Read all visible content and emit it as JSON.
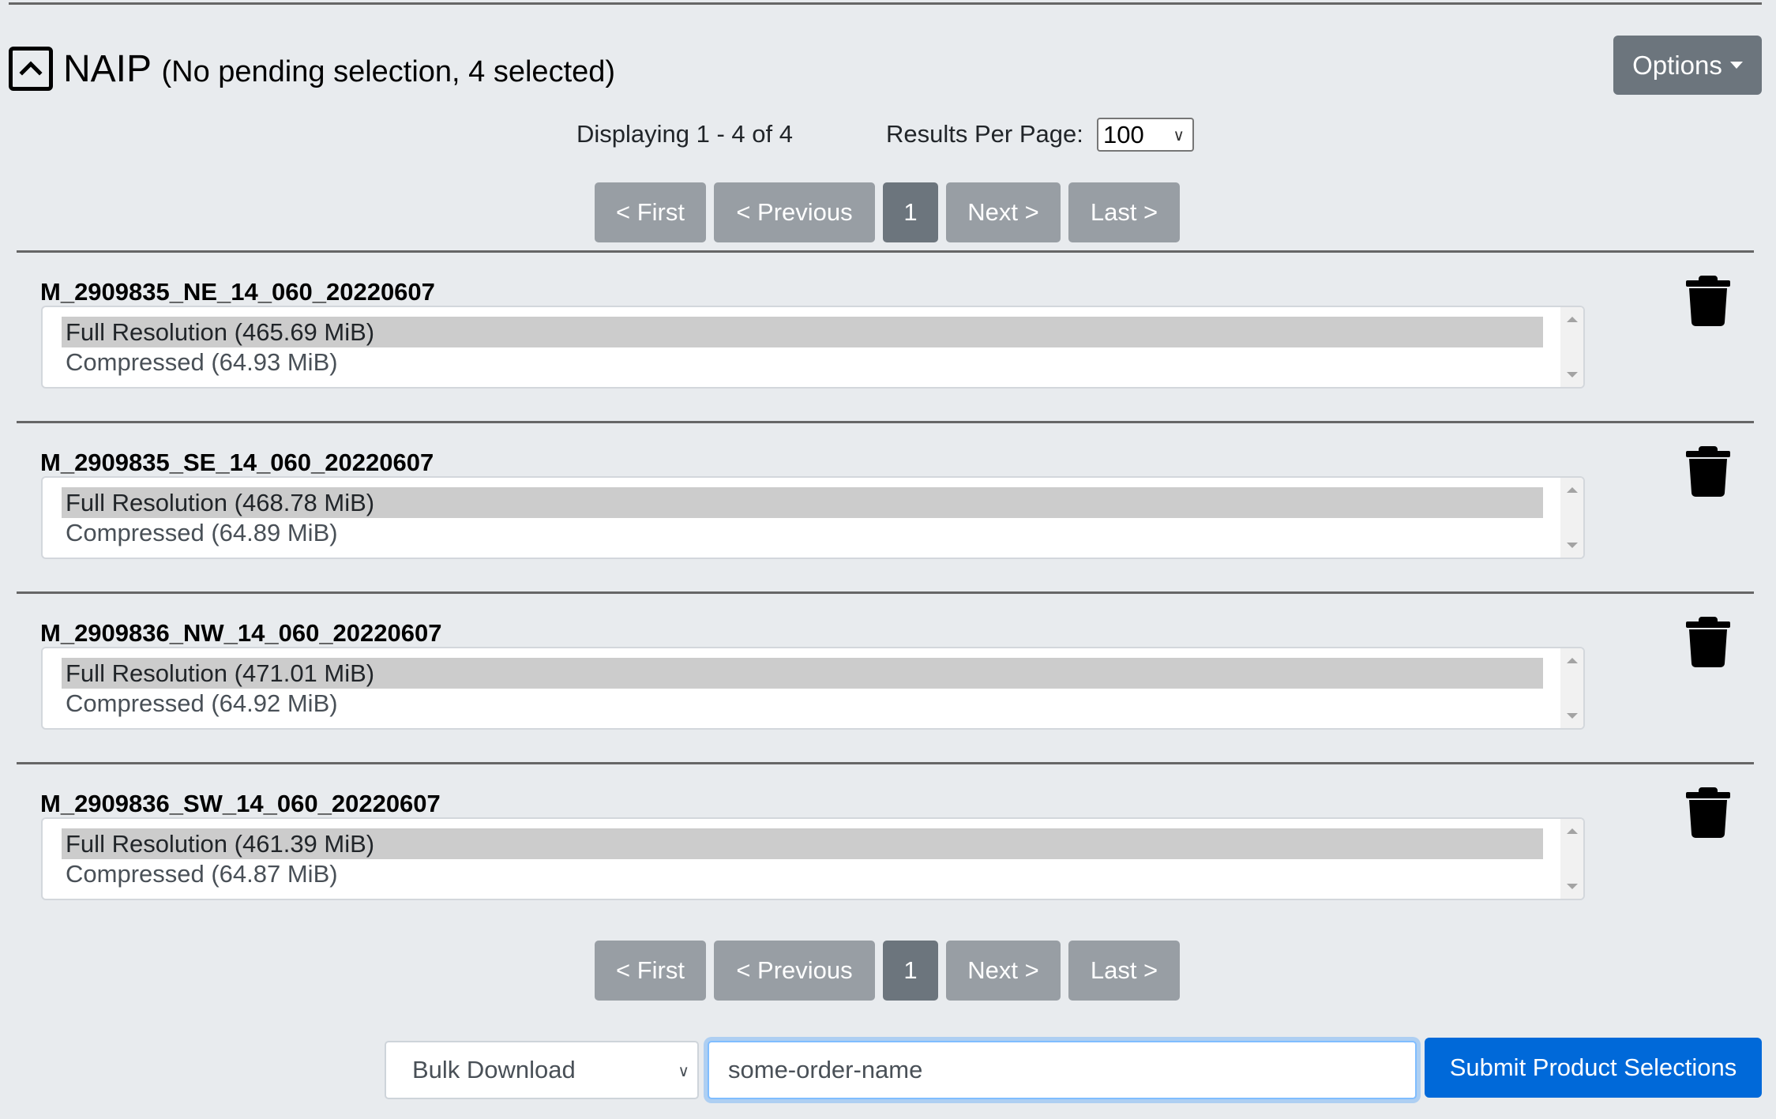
{
  "header": {
    "collection_name": "NAIP",
    "selection_status": "(No pending selection, 4 selected)",
    "options_label": "Options"
  },
  "results": {
    "displaying": "Displaying 1 - 4 of 4",
    "per_page_label": "Results Per Page:",
    "per_page_value": "100"
  },
  "pagination": {
    "first": "< First",
    "previous": "< Previous",
    "current_page": "1",
    "next": "Next >",
    "last": "Last >"
  },
  "items": [
    {
      "name": "M_2909835_NE_14_060_20220607",
      "options": [
        {
          "label": "Full Resolution (465.69 MiB)",
          "selected": true
        },
        {
          "label": "Compressed (64.93 MiB)",
          "selected": false
        }
      ]
    },
    {
      "name": "M_2909835_SE_14_060_20220607",
      "options": [
        {
          "label": "Full Resolution (468.78 MiB)",
          "selected": true
        },
        {
          "label": "Compressed (64.89 MiB)",
          "selected": false
        }
      ]
    },
    {
      "name": "M_2909836_NW_14_060_20220607",
      "options": [
        {
          "label": "Full Resolution (471.01 MiB)",
          "selected": true
        },
        {
          "label": "Compressed (64.92 MiB)",
          "selected": false
        }
      ]
    },
    {
      "name": "M_2909836_SW_14_060_20220607",
      "options": [
        {
          "label": "Full Resolution (461.39 MiB)",
          "selected": true
        },
        {
          "label": "Compressed (64.87 MiB)",
          "selected": false
        }
      ]
    }
  ],
  "footer": {
    "download_method": "Bulk Download",
    "order_name_value": "some-order-name",
    "submit_label": "Submit Product Selections"
  },
  "icons": {
    "collapse": "chevron-up-icon",
    "options_caret": "caret-down-icon",
    "remove_item": "trash-icon"
  },
  "colors": {
    "background": "#e8ebee",
    "secondary_button": "#6c757d",
    "pager_button": "#989ea4",
    "primary_button": "#0069d9",
    "selected_option": "#cccccc",
    "focus_border": "#80bdff"
  }
}
